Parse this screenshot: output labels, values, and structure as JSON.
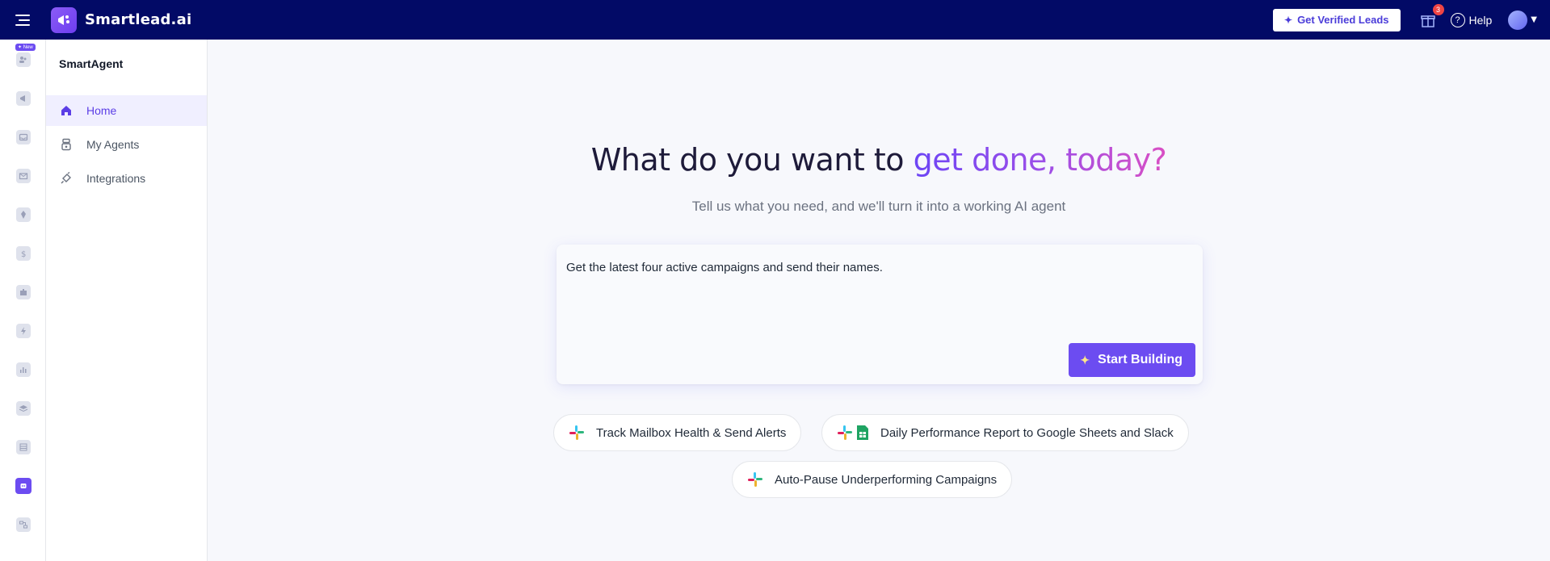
{
  "brand": {
    "name": "Smartlead.ai"
  },
  "topbar": {
    "leads_button": "Get Verified Leads",
    "gift_badge": "3",
    "help_label": "Help"
  },
  "rail": {
    "new_badge": "✦ New"
  },
  "subnav": {
    "title": "SmartAgent",
    "items": [
      {
        "label": "Home"
      },
      {
        "label": "My Agents"
      },
      {
        "label": "Integrations"
      }
    ]
  },
  "main": {
    "headline_plain": "What do you want to ",
    "headline_highlight": "get done, today?",
    "subhead": "Tell us what you need, and we'll turn it into a working AI agent",
    "prompt_value": "Get the latest four active campaigns and send their names.",
    "start_button": "Start Building",
    "suggestions": [
      {
        "label": "Track Mailbox Health & Send Alerts"
      },
      {
        "label": "Daily Performance Report to Google Sheets and Slack"
      },
      {
        "label": "Auto-Pause Underperforming Campaigns"
      }
    ]
  },
  "colors": {
    "topbar": "#020a66",
    "accent": "#6c4cf1"
  }
}
